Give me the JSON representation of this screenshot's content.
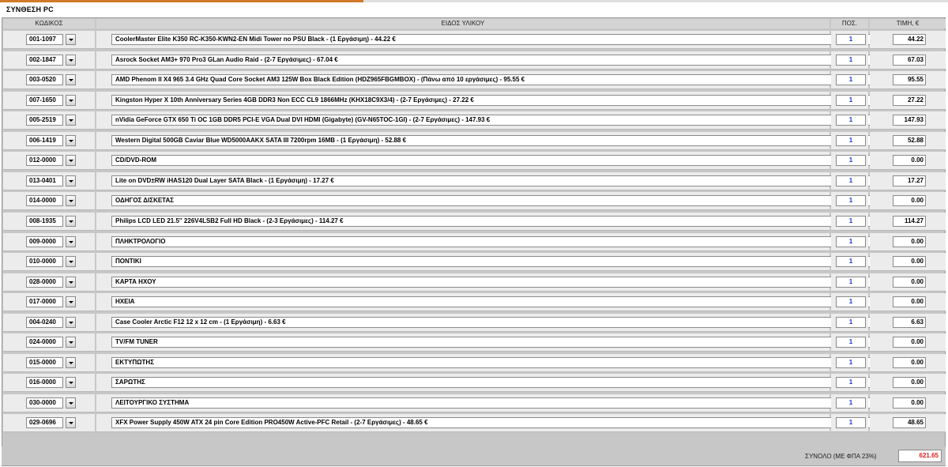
{
  "page_title": "ΣΥΝΘΕΣΗ PC",
  "headers": {
    "code": "ΚΩΔΙΚΟΣ",
    "item": "ΕΙΔΟΣ ΥΛΙΚΟΥ",
    "qty": "ΠΟΣ.",
    "price": "ΤΙΜΗ, €"
  },
  "info_label": "i",
  "rows": [
    {
      "code": "001-1097",
      "desc": "CoolerMaster Elite K350 RC-K350-KWN2-EN Midi Tower no PSU Black - (1 Εργάσιμη) - 44.22 €",
      "qty": "1",
      "price": "44.22"
    },
    {
      "code": "002-1847",
      "desc": "Asrock Socket AM3+ 970 Pro3 GLan Audio Raid - (2-7 Εργάσιμες) - 67.04 €",
      "qty": "1",
      "price": "67.03"
    },
    {
      "code": "003-0520",
      "desc": "AMD Phenom II X4 965 3.4 GHz Quad Core Socket AM3 125W Box Black Edition (HDZ965FBGMBOX) - (Πάνω από 10 εργάσιμες) - 95.55 €",
      "qty": "1",
      "price": "95.55"
    },
    {
      "code": "007-1650",
      "desc": "Kingston Hyper X 10th Anniversary Series 4GB DDR3 Non ECC CL9 1866MHz (KHX18C9X3/4) - (2-7 Εργάσιμες) - 27.22 €",
      "qty": "1",
      "price": "27.22"
    },
    {
      "code": "005-2519",
      "desc": "nVidia GeForce GTX 650 Ti OC 1GB DDR5 PCI-E VGA Dual DVI HDMI (Gigabyte) (GV-N65TOC-1GI) - (2-7 Εργάσιμες) - 147.93 €",
      "qty": "1",
      "price": "147.93"
    },
    {
      "code": "006-1419",
      "desc": "Western Digital 500GB Caviar Blue WD5000AAKX SATA III 7200rpm 16MB - (1 Εργάσιμη) - 52.88 €",
      "qty": "1",
      "price": "52.88"
    },
    {
      "code": "012-0000",
      "desc": "CD/DVD-ROM",
      "qty": "1",
      "price": "0.00"
    },
    {
      "code": "013-0401",
      "desc": "Lite on DVD±RW iHAS120 Dual Layer SATA Black - (1 Εργάσιμη) - 17.27 €",
      "qty": "1",
      "price": "17.27"
    },
    {
      "code": "014-0000",
      "desc": "ΟΔΗΓΟΣ ΔΙΣΚΕΤΑΣ",
      "qty": "1",
      "price": "0.00"
    },
    {
      "code": "008-1935",
      "desc": "Philips LCD LED 21.5'' 226V4LSB2 Full HD Black - (2-3 Εργάσιμες) - 114.27 €",
      "qty": "1",
      "price": "114.27"
    },
    {
      "code": "009-0000",
      "desc": "ΠΛΗΚΤΡΟΛΟΓΙΟ",
      "qty": "1",
      "price": "0.00"
    },
    {
      "code": "010-0000",
      "desc": "ΠΟΝΤΙΚΙ",
      "qty": "1",
      "price": "0.00"
    },
    {
      "code": "028-0000",
      "desc": "ΚΑΡΤΑ ΗΧΟΥ",
      "qty": "1",
      "price": "0.00"
    },
    {
      "code": "017-0000",
      "desc": "ΗΧΕΙΑ",
      "qty": "1",
      "price": "0.00"
    },
    {
      "code": "004-0240",
      "desc": "Case Cooler Arctic F12 12 x 12 cm - (1 Εργάσιμη) - 6.63 €",
      "qty": "1",
      "price": "6.63"
    },
    {
      "code": "024-0000",
      "desc": "TV/FM TUNER",
      "qty": "1",
      "price": "0.00"
    },
    {
      "code": "015-0000",
      "desc": "ΕΚΤΥΠΩΤΗΣ",
      "qty": "1",
      "price": "0.00"
    },
    {
      "code": "016-0000",
      "desc": "ΣΑΡΩΤΗΣ",
      "qty": "1",
      "price": "0.00"
    },
    {
      "code": "030-0000",
      "desc": "ΛΕΙΤΟΥΡΓΙΚΟ ΣΥΣΤΗΜΑ",
      "qty": "1",
      "price": "0.00"
    },
    {
      "code": "029-0696",
      "desc": "XFX Power Supply 450W ATX 24 pin Core Edition PRO450W Active-PFC Retail - (2-7 Εργάσιμες) - 48.65 €",
      "qty": "1",
      "price": "48.65"
    }
  ],
  "total": {
    "label": "ΣΥΝΟΛΟ (ΜΕ ΦΠΑ 23%)",
    "value": "621.65"
  }
}
